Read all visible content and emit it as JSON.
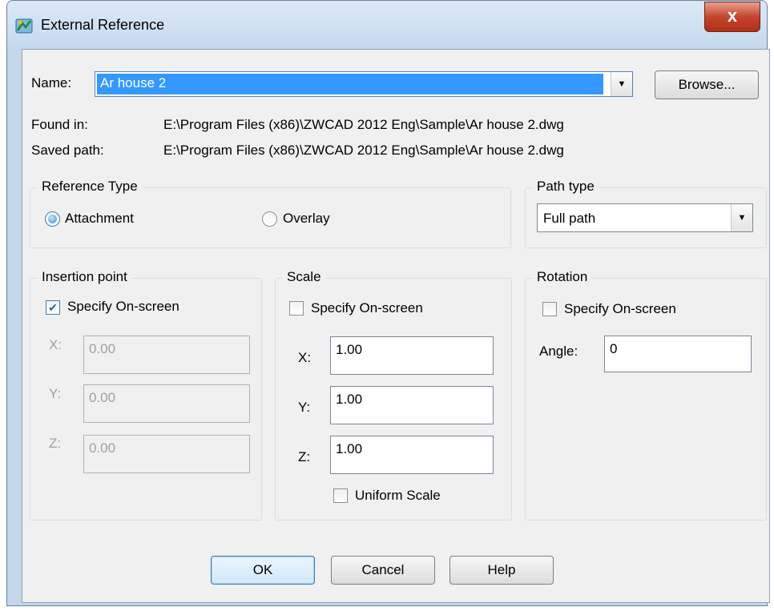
{
  "window": {
    "title": "External Reference",
    "close_label": "x"
  },
  "name_row": {
    "label": "Name:",
    "value": "Ar house 2",
    "browse_label": "Browse..."
  },
  "paths": {
    "found_label": "Found in:",
    "found_value": "E:\\Program Files (x86)\\ZWCAD 2012 Eng\\Sample\\Ar house 2.dwg",
    "saved_label": "Saved path:",
    "saved_value": "E:\\Program Files (x86)\\ZWCAD 2012 Eng\\Sample\\Ar house 2.dwg"
  },
  "reference_type": {
    "title": "Reference Type",
    "attachment_label": "Attachment",
    "overlay_label": "Overlay",
    "selected": "Attachment"
  },
  "path_type": {
    "title": "Path type",
    "value": "Full path"
  },
  "insertion": {
    "title": "Insertion point",
    "specify_label": "Specify On-screen",
    "specify_checked": true,
    "x_label": "X:",
    "x_value": "0.00",
    "y_label": "Y:",
    "y_value": "0.00",
    "z_label": "Z:",
    "z_value": "0.00"
  },
  "scale": {
    "title": "Scale",
    "specify_label": "Specify On-screen",
    "specify_checked": false,
    "x_label": "X:",
    "x_value": "1.00",
    "y_label": "Y:",
    "y_value": "1.00",
    "z_label": "Z:",
    "z_value": "1.00",
    "uniform_label": "Uniform Scale",
    "uniform_checked": false
  },
  "rotation": {
    "title": "Rotation",
    "specify_label": "Specify On-screen",
    "specify_checked": false,
    "angle_label": "Angle:",
    "angle_value": "0"
  },
  "buttons": {
    "ok": "OK",
    "cancel": "Cancel",
    "help": "Help"
  },
  "colors": {
    "selection_blue": "#3399ff",
    "window_frame": "#c4d7ec",
    "close_red": "#c5452e"
  }
}
